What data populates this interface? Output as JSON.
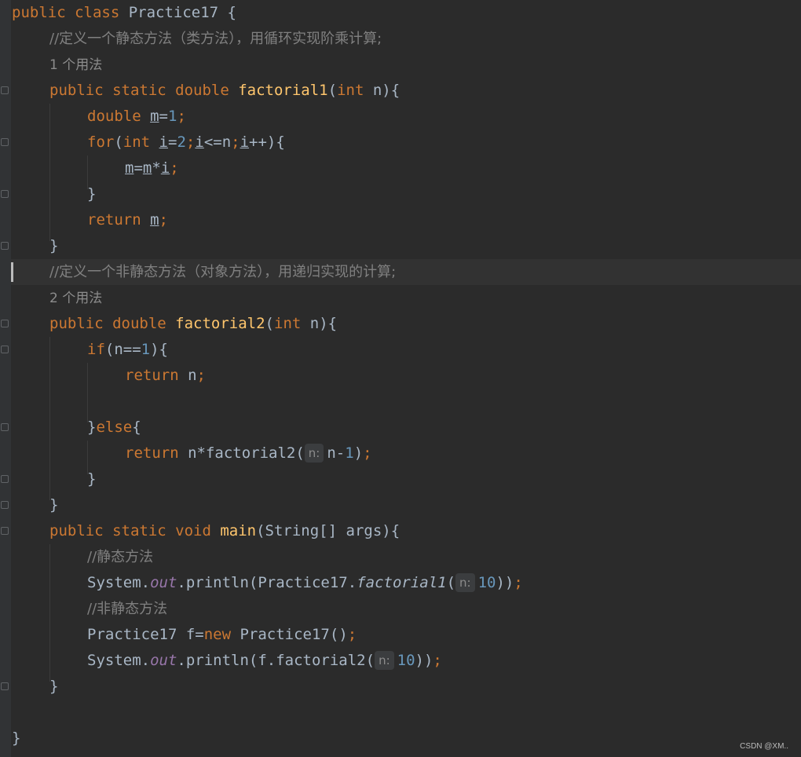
{
  "lines": [
    {
      "tokens": [
        {
          "t": "public class ",
          "c": "kw"
        },
        {
          "t": "Practice17 {"
        }
      ]
    },
    {
      "tokens": [
        {
          "t": "//定义一个静态方法（类方法），用循环实现阶乘计算;",
          "c": "cm"
        }
      ]
    },
    {
      "tokens": [
        {
          "t": "1 个用法",
          "c": "usage"
        }
      ]
    },
    {
      "tokens": [
        {
          "t": "public static double ",
          "c": "kw"
        },
        {
          "t": "factorial1",
          "c": "fn"
        },
        {
          "t": "("
        },
        {
          "t": "int ",
          "c": "kw"
        },
        {
          "t": "n){"
        }
      ]
    },
    {
      "tokens": [
        {
          "t": "double ",
          "c": "kw"
        },
        {
          "t": "m",
          "c": "ul"
        },
        {
          "t": "="
        },
        {
          "t": "1",
          "c": "num"
        },
        {
          "t": ";",
          "c": "kw"
        }
      ]
    },
    {
      "tokens": [
        {
          "t": "for",
          "c": "kw"
        },
        {
          "t": "("
        },
        {
          "t": "int ",
          "c": "kw"
        },
        {
          "t": "i",
          "c": "ul"
        },
        {
          "t": "="
        },
        {
          "t": "2",
          "c": "num"
        },
        {
          "t": ";",
          "c": "kw"
        },
        {
          "t": "i",
          "c": "ul"
        },
        {
          "t": "<=n"
        },
        {
          "t": ";",
          "c": "kw"
        },
        {
          "t": "i",
          "c": "ul"
        },
        {
          "t": "++){"
        }
      ]
    },
    {
      "tokens": [
        {
          "t": "m",
          "c": "ul"
        },
        {
          "t": "="
        },
        {
          "t": "m",
          "c": "ul"
        },
        {
          "t": "*"
        },
        {
          "t": "i",
          "c": "ul"
        },
        {
          "t": ";",
          "c": "kw"
        }
      ]
    },
    {
      "tokens": [
        {
          "t": "}"
        }
      ]
    },
    {
      "tokens": [
        {
          "t": "return ",
          "c": "kw"
        },
        {
          "t": "m",
          "c": "ul"
        },
        {
          "t": ";",
          "c": "kw"
        }
      ]
    },
    {
      "tokens": [
        {
          "t": "}"
        }
      ]
    },
    {
      "tokens": [
        {
          "t": "//定义一个非静态方法（对象方法），用递归实现的计算;",
          "c": "cm"
        }
      ]
    },
    {
      "tokens": [
        {
          "t": "2 个用法",
          "c": "usage"
        }
      ]
    },
    {
      "tokens": [
        {
          "t": "public double ",
          "c": "kw"
        },
        {
          "t": "factorial2",
          "c": "fn"
        },
        {
          "t": "("
        },
        {
          "t": "int ",
          "c": "kw"
        },
        {
          "t": "n){"
        }
      ]
    },
    {
      "tokens": [
        {
          "t": "if",
          "c": "kw"
        },
        {
          "t": "(n=="
        },
        {
          "t": "1",
          "c": "num"
        },
        {
          "t": "){"
        }
      ]
    },
    {
      "tokens": [
        {
          "t": "return ",
          "c": "kw"
        },
        {
          "t": "n"
        },
        {
          "t": ";",
          "c": "kw"
        }
      ]
    },
    {
      "tokens": []
    },
    {
      "tokens": [
        {
          "t": "}"
        },
        {
          "t": "else",
          "c": "kw"
        },
        {
          "t": "{"
        }
      ]
    },
    {
      "tokens": [
        {
          "t": "return ",
          "c": "kw"
        },
        {
          "t": "n*factorial2("
        },
        {
          "t": "n:",
          "c": "hint"
        },
        {
          "t": "n-"
        },
        {
          "t": "1",
          "c": "num"
        },
        {
          "t": ")"
        },
        {
          "t": ";",
          "c": "kw"
        }
      ]
    },
    {
      "tokens": [
        {
          "t": "}"
        }
      ]
    },
    {
      "tokens": [
        {
          "t": "}"
        }
      ]
    },
    {
      "tokens": [
        {
          "t": "public static void ",
          "c": "kw"
        },
        {
          "t": "main",
          "c": "fn"
        },
        {
          "t": "(String[] args){"
        }
      ]
    },
    {
      "tokens": [
        {
          "t": "//静态方法",
          "c": "cm"
        }
      ]
    },
    {
      "tokens": [
        {
          "t": "System."
        },
        {
          "t": "out",
          "c": "static-f"
        },
        {
          "t": ".println(Practice17."
        },
        {
          "t": "factorial1",
          "c": "ital"
        },
        {
          "t": "("
        },
        {
          "t": "n:",
          "c": "hint"
        },
        {
          "t": "10",
          "c": "num"
        },
        {
          "t": "))"
        },
        {
          "t": ";",
          "c": "kw"
        }
      ]
    },
    {
      "tokens": [
        {
          "t": "//非静态方法",
          "c": "cm"
        }
      ]
    },
    {
      "tokens": [
        {
          "t": "Practice17 f="
        },
        {
          "t": "new ",
          "c": "kw"
        },
        {
          "t": "Practice17()"
        },
        {
          "t": ";",
          "c": "kw"
        }
      ]
    },
    {
      "tokens": [
        {
          "t": "System."
        },
        {
          "t": "out",
          "c": "static-f"
        },
        {
          "t": ".println(f.factorial2("
        },
        {
          "t": "n:",
          "c": "hint"
        },
        {
          "t": "10",
          "c": "num"
        },
        {
          "t": "))"
        },
        {
          "t": ";",
          "c": "kw"
        }
      ]
    },
    {
      "tokens": [
        {
          "t": "}"
        }
      ]
    },
    {
      "tokens": []
    },
    {
      "tokens": [
        {
          "t": "}"
        }
      ]
    }
  ],
  "watermark": "CSDN @XM.."
}
